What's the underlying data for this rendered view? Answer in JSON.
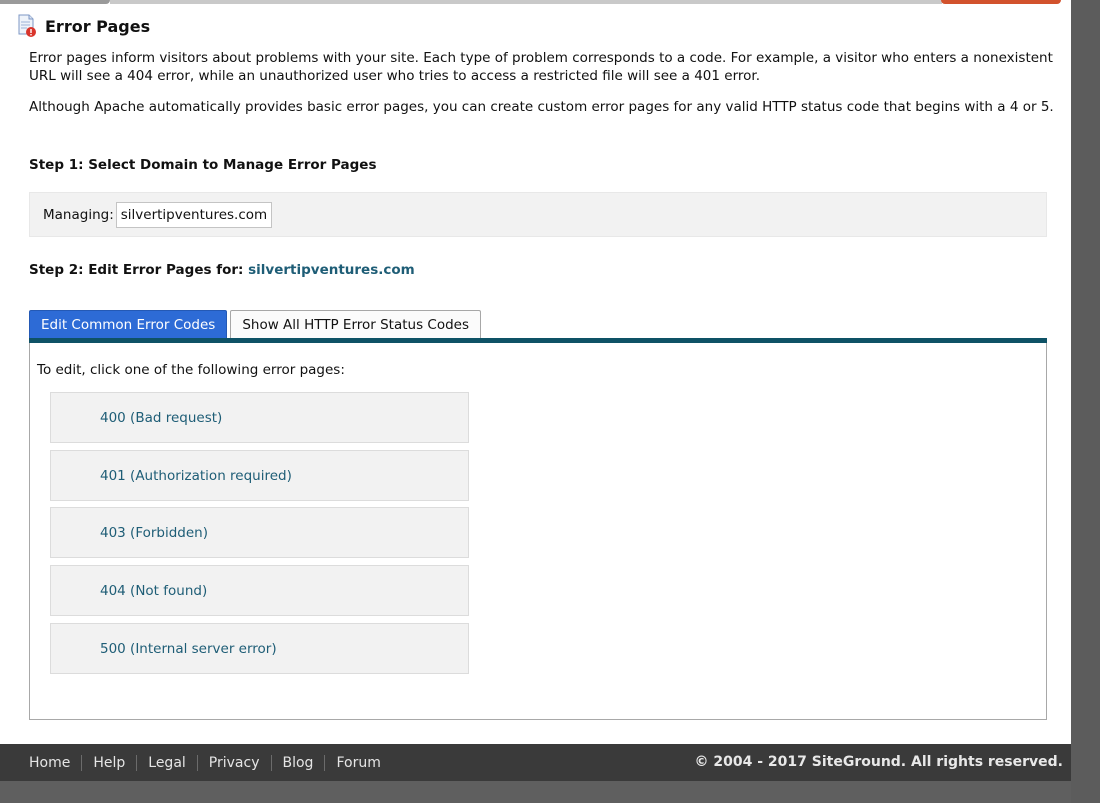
{
  "header": {
    "title": "Error Pages",
    "icon": "document-error-icon"
  },
  "intro": {
    "paragraph1": "Error pages inform visitors about problems with your site. Each type of problem corresponds to a code. For example, a visitor who enters a nonexistent URL will see a 404 error, while an unauthorized user who tries to access a restricted file will see a 401 error.",
    "paragraph2": "Although Apache automatically provides basic error pages, you can create custom error pages for any valid HTTP status code that begins with a 4 or 5."
  },
  "step1": {
    "heading": "Step 1: Select Domain to Manage Error Pages",
    "managing_label": "Managing:",
    "domain_value": "silvertipventures.com"
  },
  "step2": {
    "heading_prefix": "Step 2: Edit Error Pages for: ",
    "domain": "silvertipventures.com"
  },
  "tabs": [
    {
      "label": "Edit Common Error Codes",
      "active": true
    },
    {
      "label": "Show All HTTP Error Status Codes",
      "active": false
    }
  ],
  "content": {
    "instructions": "To edit, click one of the following error pages:",
    "error_codes": [
      "400 (Bad request)",
      "401 (Authorization required)",
      "403 (Forbidden)",
      "404 (Not found)",
      "500 (Internal server error)"
    ]
  },
  "footer": {
    "links": [
      "Home",
      "Help",
      "Legal",
      "Privacy",
      "Blog",
      "Forum"
    ],
    "copyright": "© 2004 - 2017 SiteGround. All rights reserved."
  },
  "colors": {
    "accent_link": "#1e5d76",
    "active_tab": "#2d6bd6",
    "tab_rule": "#0e5266",
    "footer_bg": "#3a3a3a"
  }
}
